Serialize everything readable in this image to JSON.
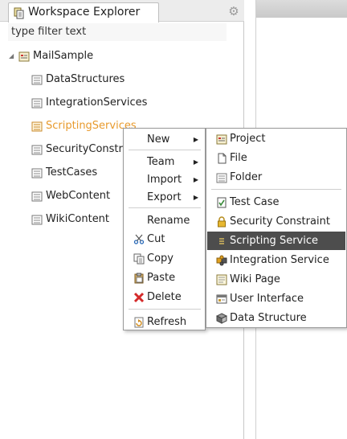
{
  "panel": {
    "tab_title": "Workspace Explorer",
    "filter_placeholder": "type filter text",
    "gear_icon": "gear-icon"
  },
  "tree": {
    "root": "MailSample",
    "items": [
      {
        "label": "DataStructures",
        "selected": false
      },
      {
        "label": "IntegrationServices",
        "selected": false
      },
      {
        "label": "ScriptingServices",
        "selected": true
      },
      {
        "label": "SecurityConstra",
        "selected": false
      },
      {
        "label": "TestCases",
        "selected": false
      },
      {
        "label": "WebContent",
        "selected": false
      },
      {
        "label": "WikiContent",
        "selected": false
      }
    ]
  },
  "context_menu": {
    "new": "New",
    "team": "Team",
    "import": "Import",
    "export": "Export",
    "rename": "Rename",
    "cut": "Cut",
    "copy": "Copy",
    "paste": "Paste",
    "delete": "Delete",
    "refresh": "Refresh"
  },
  "submenu": {
    "project": "Project",
    "file": "File",
    "folder": "Folder",
    "test_case": "Test Case",
    "security_constraint": "Security Constraint",
    "scripting_service": "Scripting Service",
    "integration_service": "Integration Service",
    "wiki_page": "Wiki Page",
    "user_interface": "User Interface",
    "data_structure": "Data Structure"
  },
  "colors": {
    "selection_text": "#e89a2c",
    "menu_highlight": "#4d4d4d"
  }
}
